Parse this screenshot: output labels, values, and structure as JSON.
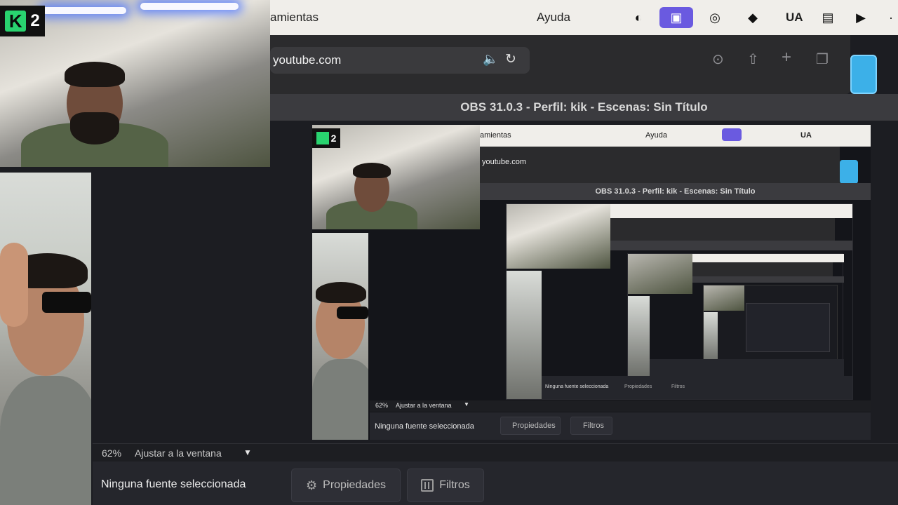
{
  "menubar": {
    "menu_partial": "amientas",
    "help": "Ayuda",
    "ua_label": "UA"
  },
  "safari": {
    "url": "youtube.com"
  },
  "obs": {
    "window_title": "OBS 31.0.3 - Perfil: kik - Escenas: Sin Título",
    "zoom_percent": "62%",
    "fit_label": "Ajustar a la ventana",
    "no_source": "Ninguna fuente seleccionada",
    "properties": "Propiedades",
    "filters": "Filtros"
  },
  "overlay": {
    "logo_text": "2"
  },
  "preview": {
    "menu_partial": "amientas",
    "help": "Ayuda",
    "ua_label": "UA",
    "url": "youtube.com",
    "window_title": "OBS 31.0.3 - Perfil: kik - Escenas: Sin Título",
    "zoom_percent": "62%",
    "fit_label": "Ajustar a la ventana",
    "no_source": "Ninguna fuente seleccionada",
    "properties": "Propiedades",
    "filters": "Filtros"
  }
}
